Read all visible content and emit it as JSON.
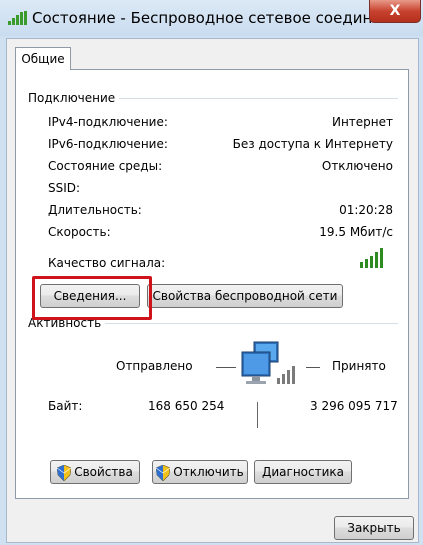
{
  "window": {
    "title": "Состояние - Беспроводное сетевое соединени...",
    "close_label": "X"
  },
  "tabs": [
    {
      "label": "Общие"
    }
  ],
  "connection": {
    "heading": "Подключение",
    "rows": [
      {
        "label": "IPv4-подключение:",
        "value": "Интернет"
      },
      {
        "label": "IPv6-подключение:",
        "value": "Без доступа к Интернету"
      },
      {
        "label": "Состояние среды:",
        "value": "Отключено"
      },
      {
        "label": "SSID:",
        "value": ""
      },
      {
        "label": "Длительность:",
        "value": "01:20:28"
      },
      {
        "label": "Скорость:",
        "value": "19.5 Мбит/с"
      }
    ],
    "signal_label": "Качество сигнала:",
    "signal_bars": 5,
    "details_button": "Сведения...",
    "wireless_props_button": "Свойства беспроводной сети"
  },
  "activity": {
    "heading": "Активность",
    "sent_label": "Отправлено",
    "received_label": "Принято",
    "bytes_label": "Байт:",
    "bytes_sent": "168 650 254",
    "bytes_received": "3 296 095 717"
  },
  "buttons": {
    "properties": "Свойства",
    "disable": "Отключить",
    "diagnose": "Диагностика",
    "close": "Закрыть"
  },
  "colors": {
    "signal": "#2e8b22",
    "highlight": "#d0121b"
  }
}
